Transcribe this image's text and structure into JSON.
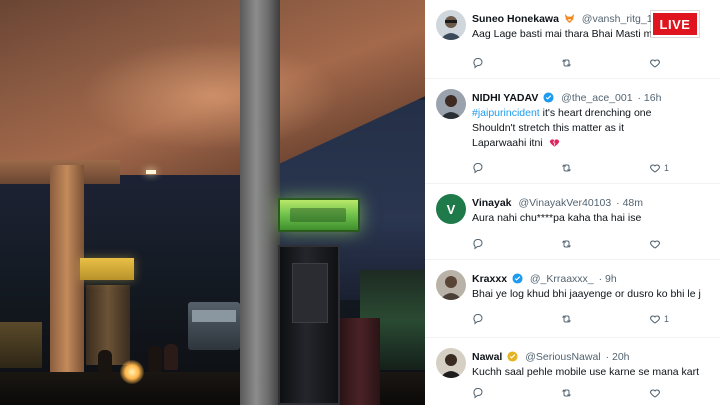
{
  "badge": {
    "live": "LIVE"
  },
  "comments": [
    {
      "name": "Suneo Honekawa",
      "handle": "@vansh_ritg_1",
      "meta": "",
      "text": "Aag Lage basti mai thara Bhai Masti mai",
      "avatar_color": "#6b5a4a",
      "avatar_letter": "",
      "like_count": "",
      "badge_icon": "fox-emoji-icon"
    },
    {
      "name": "NIDHI YADAV",
      "handle": "@the_ace_001",
      "meta": "· 16h",
      "hashtag": "#jaipurincident",
      "text_line1": " it's heart drenching one",
      "text_line2": "Shouldn't stretch this matter as it",
      "text_line3": "Laparwaahi itni",
      "avatar_color": "#5a6472",
      "like_count": "1",
      "badge_icon": "verified-badge-icon"
    },
    {
      "name": "Vinayak",
      "handle": "@VinayakVer40103",
      "meta": "· 48m",
      "text": "Aura nahi chu****pa kaha tha hai ise",
      "avatar_color": "#1f7a4a",
      "avatar_letter": "V",
      "like_count": ""
    },
    {
      "name": "Kraxxx",
      "handle": "@_Krraaxxx_",
      "meta": "· 9h",
      "text": "Bhai ye log khud bhi jaayenge or dusro ko bhi le j",
      "avatar_color": "#7a6a5a",
      "like_count": "1",
      "badge_icon": "verified-badge-icon"
    },
    {
      "name": "Nawal",
      "handle": "@SeriousNawal",
      "meta": "· 20h",
      "text": "Kuchh saal pehle mobile use karne se mana kart",
      "avatar_color": "#3a3a3a",
      "like_count": "",
      "badge_icon": "gold-verified-icon"
    }
  ],
  "colors": {
    "accent": "#1d9bf0",
    "live_red": "#e0141e",
    "muted": "#536471",
    "text": "#0f1419"
  }
}
